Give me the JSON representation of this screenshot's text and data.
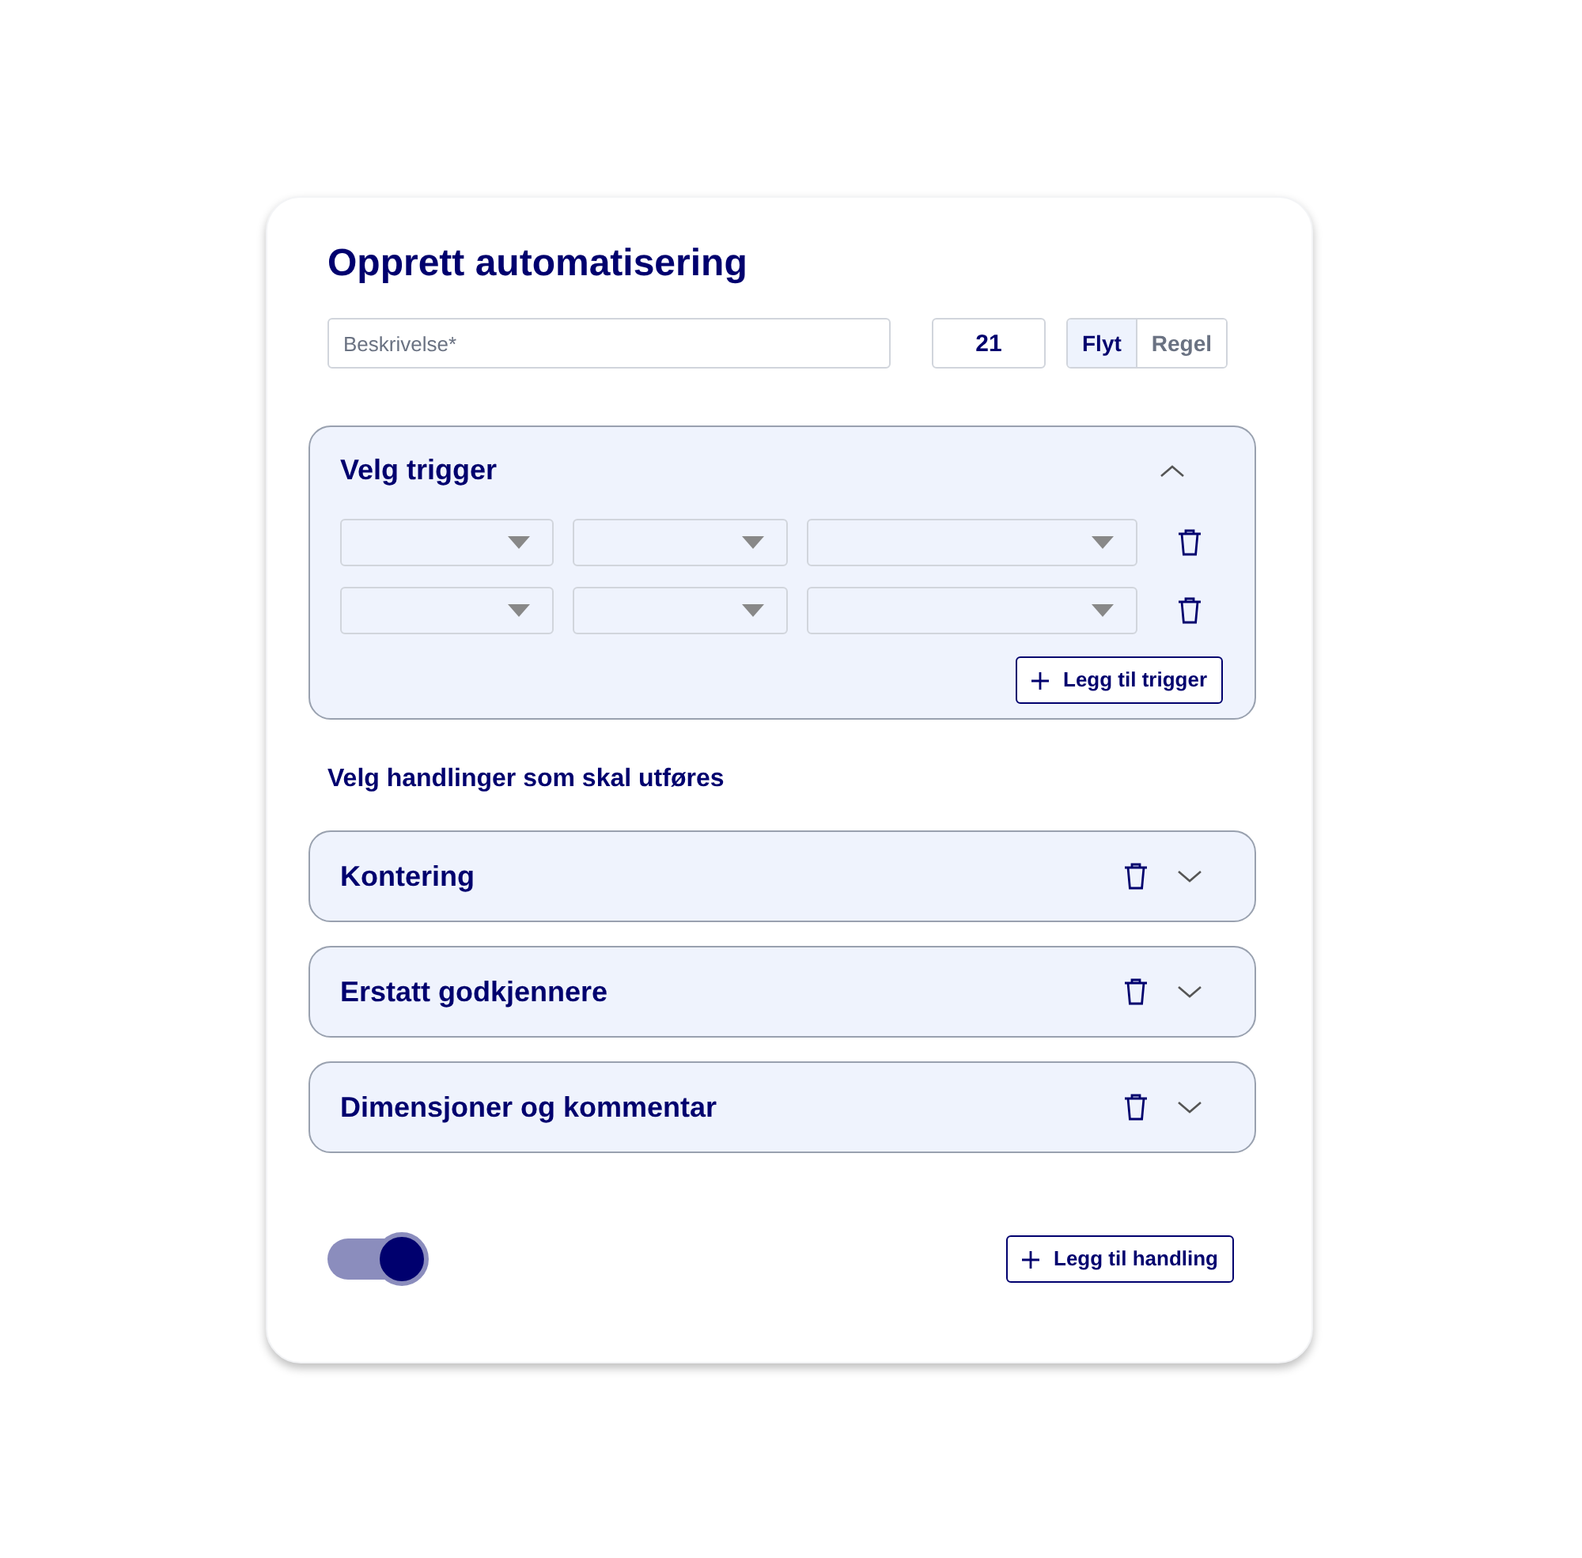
{
  "title": "Opprett automatisering",
  "description": {
    "placeholder": "Beskrivelse*"
  },
  "number": {
    "value": "21"
  },
  "mode_tabs": [
    {
      "label": "Flyt",
      "selected": true
    },
    {
      "label": "Regel",
      "selected": false
    }
  ],
  "trigger": {
    "title": "Velg trigger",
    "expanded": true,
    "rows": [
      {
        "removable": true
      },
      {
        "removable": true
      }
    ],
    "add_button": "Legg til trigger"
  },
  "actions_heading": "Velg handlinger som skal utføres",
  "actions": [
    {
      "title": "Kontering",
      "expanded": false
    },
    {
      "title": "Erstatt godkjennere",
      "expanded": false
    },
    {
      "title": "Dimensjoner og kommentar",
      "expanded": false
    }
  ],
  "toggle": {
    "on": true
  },
  "add_action_button": "Legg til handling"
}
